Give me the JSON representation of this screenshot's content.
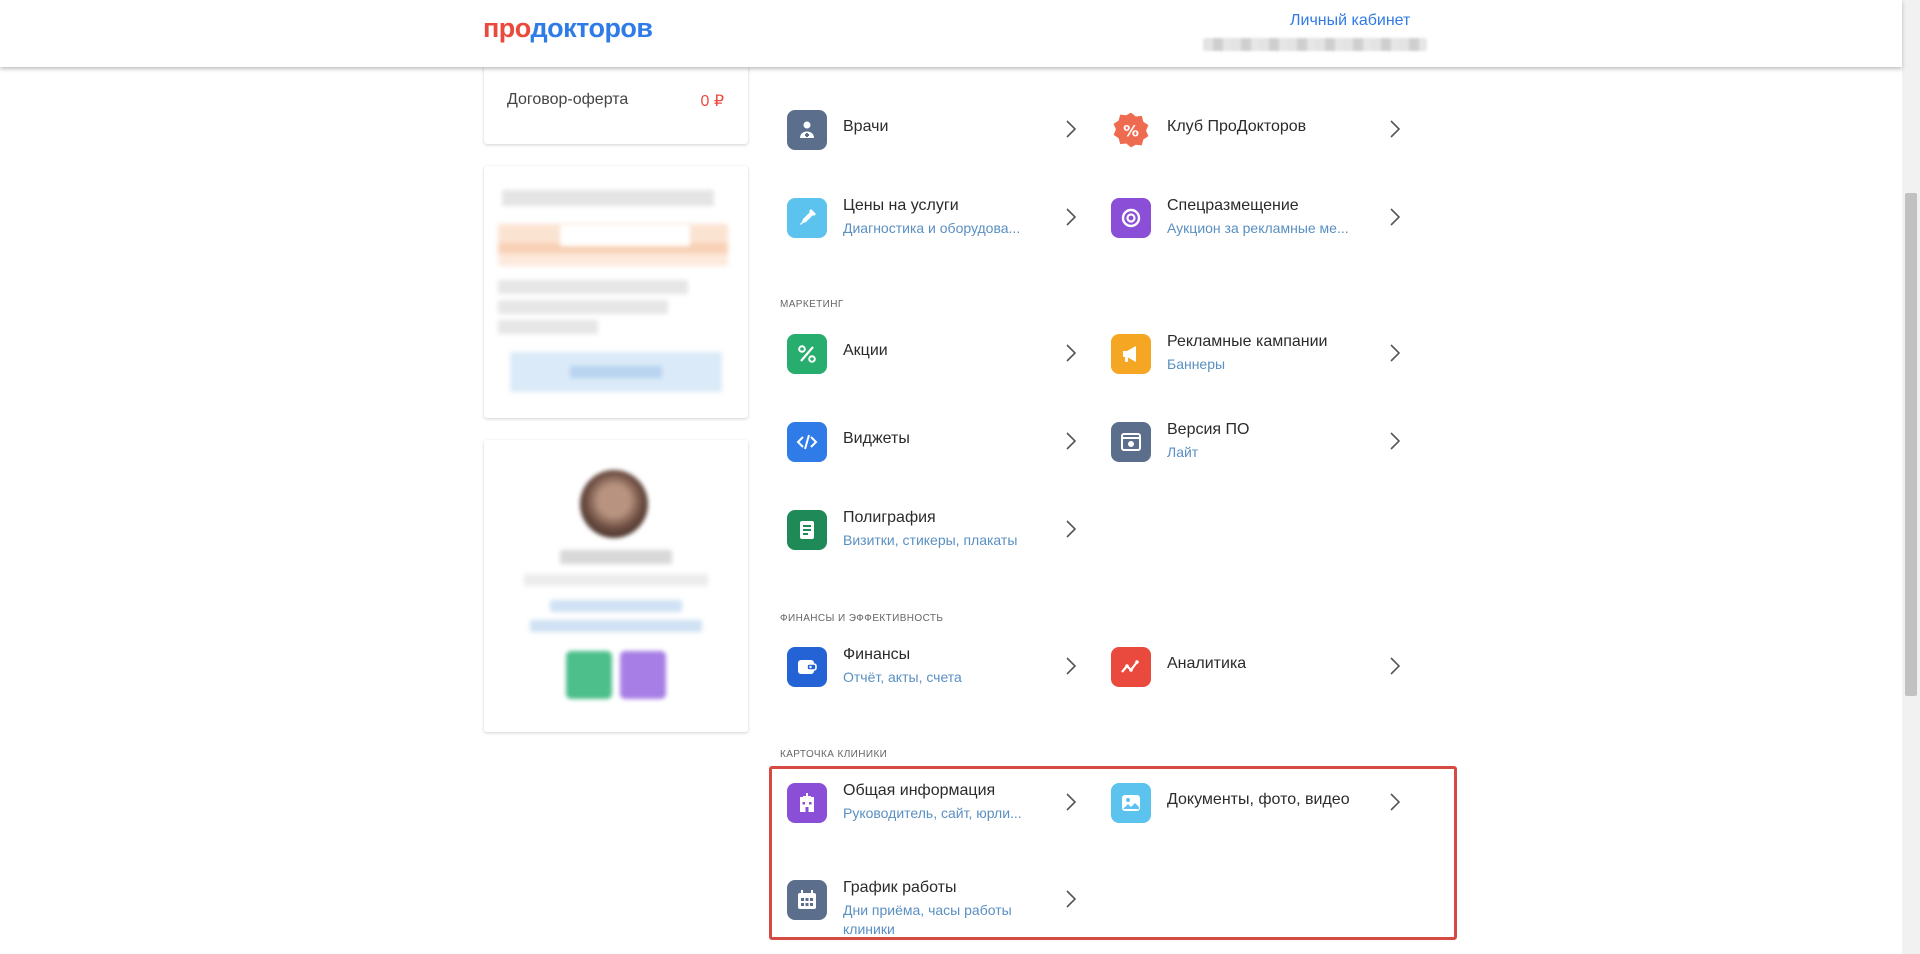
{
  "header": {
    "logo_part1": "про",
    "logo_part2": "докторов",
    "cabinet_link": "Личный кабинет"
  },
  "left": {
    "contract_label": "Договор-оферта",
    "contract_amount": "0 ₽"
  },
  "sections": {
    "marketing": "МАРКЕТИНГ",
    "finance": "ФИНАНСЫ И ЭФФЕКТИВНОСТЬ",
    "clinic_card": "КАРТОЧКА КЛИНИКИ"
  },
  "items": {
    "doctors": {
      "title": "Врачи",
      "icon": "doctor-icon",
      "color": "#5b6f8d"
    },
    "club": {
      "title": "Клуб ПроДокторов",
      "icon": "percent-badge-icon",
      "color": "#ee6b50"
    },
    "prices": {
      "title": "Цены на услуги",
      "subtitle": "Диагностика и оборудова...",
      "icon": "syringe-icon",
      "color": "#5cc3ef"
    },
    "special": {
      "title": "Спецразмещение",
      "subtitle": "Аукцион за рекламные ме...",
      "icon": "target-icon",
      "color": "#8a4fd6"
    },
    "promotions": {
      "title": "Акции",
      "icon": "percent-icon",
      "color": "#27ad6e"
    },
    "ads": {
      "title": "Рекламные кампании",
      "subtitle": "Баннеры",
      "icon": "megaphone-icon",
      "color": "#f5a623"
    },
    "widgets": {
      "title": "Виджеты",
      "icon": "code-icon",
      "color": "#2f7be8"
    },
    "version": {
      "title": "Версия ПО",
      "subtitle": "Лайт",
      "icon": "software-icon",
      "color": "#5b6f8d"
    },
    "printing": {
      "title": "Полиграфия",
      "subtitle": "Визитки, стикеры, плакаты",
      "icon": "document-icon",
      "color": "#1f8a57"
    },
    "finances": {
      "title": "Финансы",
      "subtitle": "Отчёт, акты, счета",
      "icon": "wallet-icon",
      "color": "#2463d6"
    },
    "analytics": {
      "title": "Аналитика",
      "icon": "chart-line-icon",
      "color": "#ea4a3e"
    },
    "general": {
      "title": "Общая информация",
      "subtitle": "Руководитель, сайт, юрли...",
      "icon": "hospital-icon",
      "color": "#8a4fd6"
    },
    "docs": {
      "title": "Документы, фото, видео",
      "icon": "image-icon",
      "color": "#5cc3ef"
    },
    "schedule": {
      "title": "График работы",
      "subtitle_line1": "Дни приёма, часы работы",
      "subtitle_line2": "клиники",
      "icon": "calendar-icon",
      "color": "#5b6f8d"
    }
  }
}
